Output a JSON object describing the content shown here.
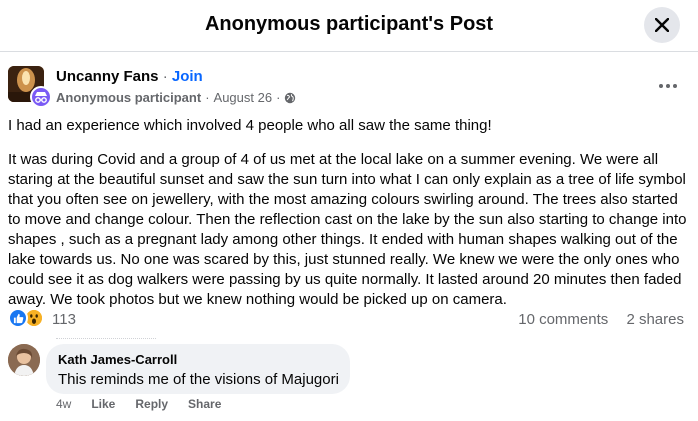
{
  "modal": {
    "title": "Anonymous participant's Post"
  },
  "post": {
    "group_name": "Uncanny Fans",
    "separator": "·",
    "join_label": "Join",
    "author": "Anonymous participant",
    "date": "August 26",
    "privacy_icon": "globe-icon",
    "paragraphs": [
      "I had an experience which involved 4 people who all saw the same thing!",
      "It was during Covid and a group of 4 of us met at the local lake on a summer evening. We were all staring at the beautiful sunset and saw the sun turn into what I can only explain as a tree of life symbol that you often see on jewellery, with the most amazing colours swirling around. The trees also started to move and change colour. Then the reflection cast on the lake by the sun also starting to change into shapes , such as a pregnant lady among other things. It ended with human shapes walking out of the lake towards us. No one was scared by this,  just stunned really. We knew we were the only ones who could see it as dog walkers were passing by us quite normally. It lasted around 20 minutes then faded away. We took photos but we knew nothing would be picked up on camera."
    ],
    "reactions": {
      "icons": [
        "like-icon",
        "wow-icon"
      ],
      "count": "113"
    },
    "comments_count": "10 comments",
    "shares_count": "2 shares"
  },
  "comment": {
    "name": "Kath James-Carroll",
    "text": "This reminds me of the visions of Majugori",
    "time": "4w",
    "actions": [
      "Like",
      "Reply",
      "Share"
    ]
  },
  "colors": {
    "accent": "#0866ff",
    "like": "#1877f2",
    "wow": "#f7b125",
    "muted": "#65676b",
    "bubble": "#f0f2f5"
  }
}
